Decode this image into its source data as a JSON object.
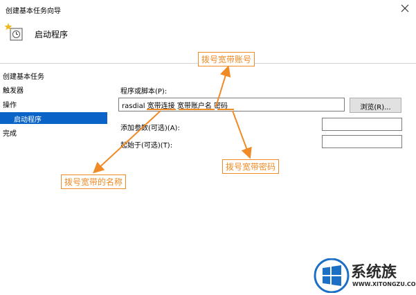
{
  "window": {
    "title": "创建基本任务向导"
  },
  "header": {
    "title": "启动程序"
  },
  "left_nav": {
    "items": [
      {
        "label": "创建基本任务",
        "active": false
      },
      {
        "label": "触发器",
        "active": false
      },
      {
        "label": "操作",
        "active": false
      },
      {
        "label": "启动程序",
        "active": true
      },
      {
        "label": "完成",
        "active": false
      }
    ]
  },
  "form": {
    "program_label": "程序或脚本(P):",
    "program_value": {
      "part1": "rasdial ",
      "part2": "宽带连接",
      "part3": " ",
      "part4": "宽带账户名",
      "part5": " ",
      "part6": "密码"
    },
    "browse_label": "浏览(R)...",
    "args_label": "添加参数(可选)(A):",
    "args_value": "",
    "startin_label": "起始于(可选)(T):",
    "startin_value": ""
  },
  "annotations": {
    "account": "拨号宽带账号",
    "name": "拨号宽带的名称",
    "password": "拨号宽带密码"
  },
  "watermark": {
    "brand": "系统族",
    "url": "WWW.XITONGZU.COM"
  },
  "colors": {
    "accent": "#0a64c8",
    "annotation": "#f08a24"
  }
}
